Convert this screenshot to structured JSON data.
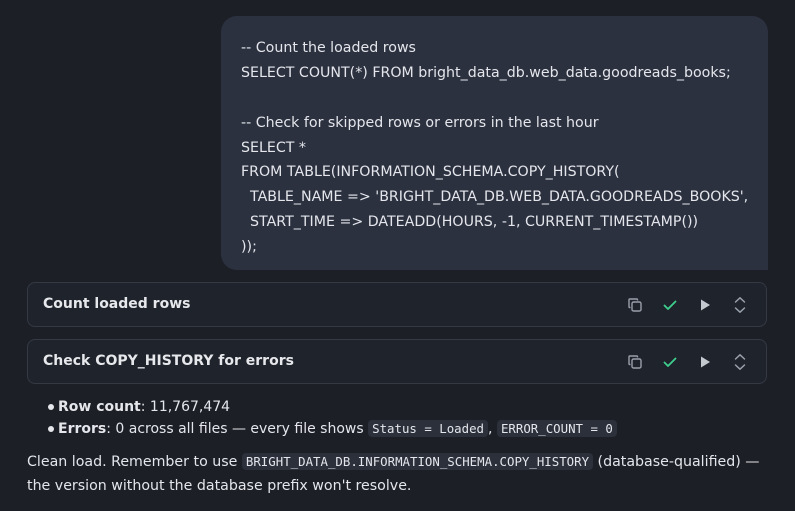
{
  "user_message": {
    "lines": [
      "-- Count the loaded rows",
      "SELECT COUNT(*) FROM bright_data_db.web_data.goodreads_books;",
      "",
      "-- Check for skipped rows or errors in the last hour",
      "SELECT *",
      "FROM TABLE(INFORMATION_SCHEMA.COPY_HISTORY(",
      "  TABLE_NAME => 'BRIGHT_DATA_DB.WEB_DATA.GOODREADS_BOOKS',",
      "  START_TIME => DATEADD(HOURS, -1, CURRENT_TIMESTAMP())",
      "));"
    ]
  },
  "tool_calls": [
    {
      "title": "Count loaded rows"
    },
    {
      "title": "Check COPY_HISTORY for errors"
    }
  ],
  "icons": {
    "copy": "copy-icon",
    "check": "check-icon",
    "run": "play-icon",
    "expand": "chevron-up-down-icon"
  },
  "colors": {
    "background": "#1c1f26",
    "bubble": "#2c3140",
    "check": "#3ecf8e",
    "icon": "#9aa0aa"
  },
  "results": {
    "row_count_label": "Row count",
    "row_count_value": ": 11,767,474",
    "errors_label": "Errors",
    "errors_text": ": 0 across all files — every file shows ",
    "errors_code_1": "Status = Loaded",
    "errors_sep": ", ",
    "errors_code_2": "ERROR_COUNT = 0"
  },
  "summary": {
    "text_1": "Clean load. Remember to use ",
    "code": "BRIGHT_DATA_DB.INFORMATION_SCHEMA.COPY_HISTORY",
    "text_2": " (database-qualified) — the version without the database prefix won't resolve."
  }
}
